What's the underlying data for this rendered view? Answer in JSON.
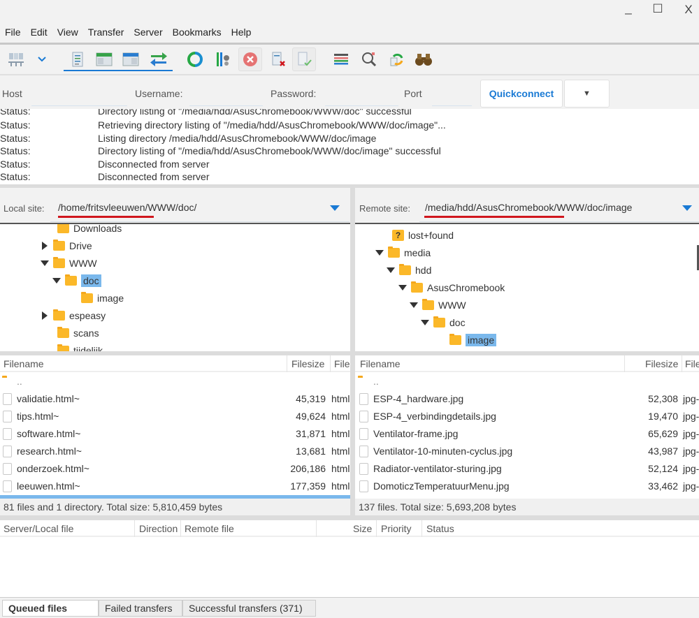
{
  "window": {
    "minimize_icon": "minimize-icon",
    "maximize_icon": "maximize-icon",
    "close_icon": "close-icon",
    "minimize_glyph": "_",
    "maximize_glyph": "☐",
    "close_glyph": "X"
  },
  "menu": [
    "File",
    "Edit",
    "View",
    "Transfer",
    "Server",
    "Bookmarks",
    "Help"
  ],
  "toolbar": [
    {
      "name": "site-manager-icon"
    },
    {
      "name": "site-manager-dropdown-icon"
    },
    {
      "name": "toggle-message-log-icon"
    },
    {
      "name": "toggle-local-tree-icon"
    },
    {
      "name": "toggle-remote-tree-icon"
    },
    {
      "name": "toggle-transfer-queue-icon"
    },
    {
      "name": "refresh-icon"
    },
    {
      "name": "process-queue-icon"
    },
    {
      "name": "cancel-operation-icon"
    },
    {
      "name": "disconnect-icon"
    },
    {
      "name": "reconnect-icon"
    },
    {
      "name": "directory-filters-icon"
    },
    {
      "name": "compare-directories-icon"
    },
    {
      "name": "sync-browsing-icon"
    },
    {
      "name": "search-files-icon"
    }
  ],
  "quickconnect": {
    "host_label": "Host",
    "username_label": "Username:",
    "password_label": "Password:",
    "port_label": "Port",
    "host_value": "",
    "username_value": "",
    "password_value": "",
    "port_value": "",
    "button_label": "Quickconnect",
    "dropdown_glyph": "▼"
  },
  "log": [
    {
      "k": "Status:",
      "v": "Directory listing of \"/media/hdd/AsusChromebook/WWW/doc\" successful"
    },
    {
      "k": "Status:",
      "v": "Retrieving directory listing of \"/media/hdd/AsusChromebook/WWW/doc/image\"..."
    },
    {
      "k": "Status:",
      "v": "Listing directory /media/hdd/AsusChromebook/WWW/doc/image"
    },
    {
      "k": "Status:",
      "v": "Directory listing of \"/media/hdd/AsusChromebook/WWW/doc/image\" successful"
    },
    {
      "k": "Status:",
      "v": "Disconnected from server"
    },
    {
      "k": "Status:",
      "v": "Disconnected from server"
    }
  ],
  "local": {
    "site_label": "Local site:",
    "path": "/home/fritsvleeuwen/WWW/doc/",
    "tree": [
      {
        "label": "Downloads",
        "level": 0,
        "toggle": "none"
      },
      {
        "label": "Drive",
        "level": 0,
        "toggle": "collapsed"
      },
      {
        "label": "WWW",
        "level": 0,
        "toggle": "expanded"
      },
      {
        "label": "doc",
        "level": 1,
        "toggle": "expanded",
        "selected": true
      },
      {
        "label": "image",
        "level": 2,
        "toggle": "none"
      },
      {
        "label": "espeasy",
        "level": 0,
        "toggle": "collapsed"
      },
      {
        "label": "scans",
        "level": 0,
        "toggle": "none"
      },
      {
        "label": "tijdelijk",
        "level": 0,
        "toggle": "none"
      }
    ],
    "columns": {
      "filename": "Filename",
      "filesize": "Filesize",
      "filetype": "File"
    },
    "parent_dir": "..",
    "files": [
      {
        "name": "validatie.html~",
        "size": "45,319",
        "type": "html"
      },
      {
        "name": "tips.html~",
        "size": "49,624",
        "type": "html"
      },
      {
        "name": "software.html~",
        "size": "31,871",
        "type": "html"
      },
      {
        "name": "research.html~",
        "size": "13,681",
        "type": "html"
      },
      {
        "name": "onderzoek.html~",
        "size": "206,186",
        "type": "html"
      },
      {
        "name": "leeuwen.html~",
        "size": "177,359",
        "type": "html"
      }
    ],
    "status": "81 files and 1 directory. Total size: 5,810,459 bytes"
  },
  "remote": {
    "site_label": "Remote site:",
    "path": "/media/hdd/AsusChromebook/WWW/doc/image",
    "tree": [
      {
        "label": "lost+found",
        "level": 1,
        "toggle": "none",
        "icon": "unknown"
      },
      {
        "label": "media",
        "level": 0,
        "toggle": "expanded"
      },
      {
        "label": "hdd",
        "level": 1,
        "toggle": "expanded"
      },
      {
        "label": "AsusChromebook",
        "level": 2,
        "toggle": "expanded"
      },
      {
        "label": "WWW",
        "level": 3,
        "toggle": "expanded"
      },
      {
        "label": "doc",
        "level": 4,
        "toggle": "expanded"
      },
      {
        "label": "image",
        "level": 5,
        "toggle": "none",
        "selected": true
      }
    ],
    "unknown_glyph": "?",
    "columns": {
      "filename": "Filename",
      "filesize": "Filesize",
      "filetype": "File"
    },
    "parent_dir": "..",
    "files": [
      {
        "name": "ESP-4_hardware.jpg",
        "size": "52,308",
        "type": "jpg-"
      },
      {
        "name": "ESP-4_verbindingdetails.jpg",
        "size": "19,470",
        "type": "jpg-"
      },
      {
        "name": "Ventilator-frame.jpg",
        "size": "65,629",
        "type": "jpg-"
      },
      {
        "name": "Ventilator-10-minuten-cyclus.jpg",
        "size": "43,987",
        "type": "jpg-"
      },
      {
        "name": "Radiator-ventilator-sturing.jpg",
        "size": "52,124",
        "type": "jpg-"
      },
      {
        "name": "DomoticzTemperatuurMenu.jpg",
        "size": "33,462",
        "type": "jpg-"
      }
    ],
    "status": "137 files. Total size: 5,693,208 bytes"
  },
  "queue": {
    "columns": [
      "Server/Local file",
      "Direction",
      "Remote file",
      "Size",
      "Priority",
      "Status"
    ]
  },
  "tabs": [
    {
      "label": "Queued files",
      "active": true
    },
    {
      "label": "Failed transfers",
      "active": false
    },
    {
      "label": "Successful transfers (371)",
      "active": false
    }
  ],
  "colors": {
    "accent": "#1a7ad4",
    "selection": "#7ab8ec",
    "folder": "#fbb829",
    "underline": "#d0161d"
  }
}
